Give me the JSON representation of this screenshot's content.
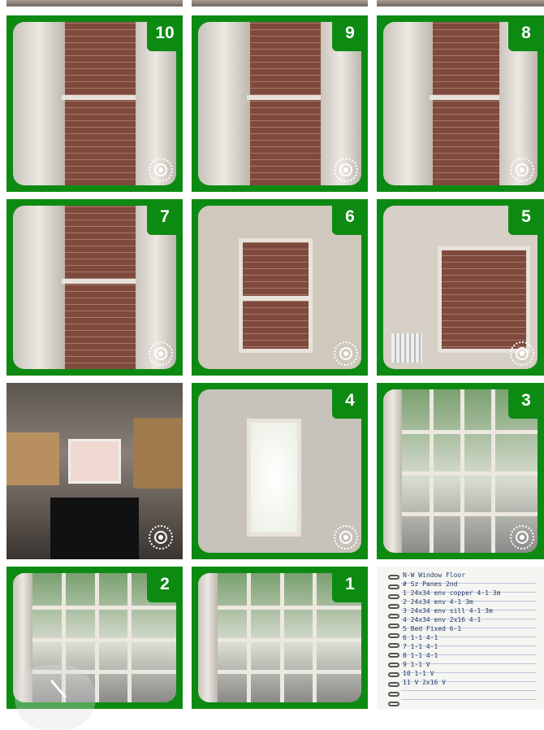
{
  "grid": {
    "tiles": [
      {
        "id": "t10",
        "badge": "10",
        "selected": true,
        "live": true,
        "scene": "window-brick"
      },
      {
        "id": "t9",
        "badge": "9",
        "selected": true,
        "live": true,
        "scene": "window-brick"
      },
      {
        "id": "t8",
        "badge": "8",
        "selected": true,
        "live": true,
        "scene": "window-brick"
      },
      {
        "id": "t7",
        "badge": "7",
        "selected": true,
        "live": true,
        "scene": "window-brick"
      },
      {
        "id": "t6",
        "badge": "6",
        "selected": true,
        "live": true,
        "scene": "window-room"
      },
      {
        "id": "t5",
        "badge": "5",
        "selected": true,
        "live": true,
        "scene": "window-radiator"
      },
      {
        "id": "tk",
        "badge": "",
        "selected": false,
        "live": true,
        "scene": "kitchen"
      },
      {
        "id": "t4",
        "badge": "4",
        "selected": true,
        "live": true,
        "scene": "window-bright"
      },
      {
        "id": "t3",
        "badge": "3",
        "selected": true,
        "live": true,
        "scene": "window-street"
      },
      {
        "id": "t2",
        "badge": "2",
        "selected": true,
        "live": true,
        "scene": "window-street"
      },
      {
        "id": "t1",
        "badge": "1",
        "selected": true,
        "live": true,
        "scene": "window-street"
      },
      {
        "id": "tn",
        "badge": "",
        "selected": false,
        "live": true,
        "scene": "notebook"
      }
    ],
    "notebook_lines": [
      "N-W Window Floor",
      "# Sz        Panes       2nd",
      "1 24x34 env   copper  4-1 3m",
      "2 24x34 env           4-1 3m",
      "3 24x34 env   sill    4-1 3m",
      "4 24x34 env   2x16    4-1",
      "5 Bed Fixed           6-1",
      "6 1-1                 4-1",
      "7 1-1                 4-1",
      "8 1-1                 4-1",
      "9 1-1                 V",
      "10 1-1                V",
      "11 V          2x16    V"
    ],
    "colors": {
      "selection": "#0d8a12",
      "badge_text": "#ffffff"
    }
  }
}
